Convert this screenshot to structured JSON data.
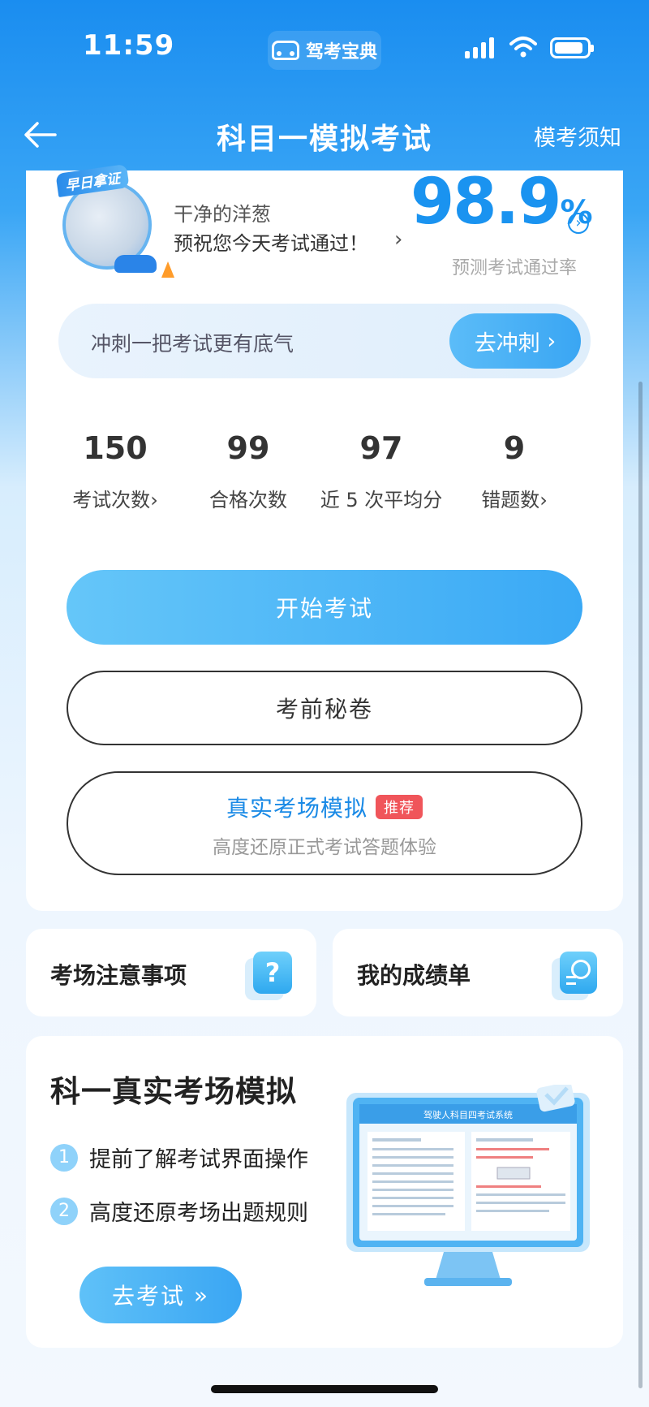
{
  "status_bar": {
    "time": "11:59",
    "app_name": "驾考宝典"
  },
  "nav": {
    "title": "科目一模拟考试",
    "right_link": "模考须知"
  },
  "profile": {
    "badge": "早日拿证",
    "username": "干净的洋葱",
    "greeting": "预祝您今天考试通过！",
    "pass_rate_value": "98.9",
    "pass_rate_unit": "%",
    "pass_rate_label": "预测考试通过率"
  },
  "sprint": {
    "text": "冲刺一把考试更有底气",
    "button": "去冲刺"
  },
  "stats": [
    {
      "value": "150",
      "label": "考试次数"
    },
    {
      "value": "99",
      "label": "合格次数"
    },
    {
      "value": "97",
      "label": "近 5 次平均分"
    },
    {
      "value": "9",
      "label": "错题数"
    }
  ],
  "actions": {
    "start": "开始考试",
    "secret": "考前秘卷",
    "simulation_title": "真实考场模拟",
    "simulation_tag": "推荐",
    "simulation_sub": "高度还原正式考试答题体验"
  },
  "cards": {
    "notice": "考场注意事项",
    "report": "我的成绩单"
  },
  "promo": {
    "title": "科一真实考场模拟",
    "items": [
      {
        "num": "1",
        "text": "提前了解考试界面操作"
      },
      {
        "num": "2",
        "text": "高度还原考场出题规则"
      }
    ],
    "button": "去考试",
    "screen_heading": "驾驶人科目四考试系统"
  },
  "colors": {
    "primary": "#1a93f0",
    "accent_tag": "#f0555a"
  }
}
